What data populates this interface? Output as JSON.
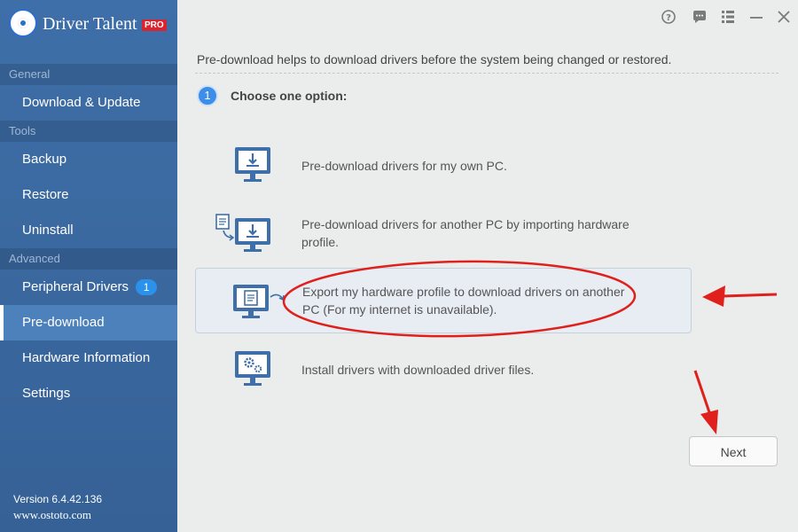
{
  "app": {
    "title": "Driver Talent",
    "badge": "PRO"
  },
  "sidebar": {
    "sections": [
      {
        "label": "General"
      },
      {
        "label": "Tools"
      },
      {
        "label": "Advanced"
      }
    ],
    "items": [
      {
        "label": "Download & Update"
      },
      {
        "label": "Backup"
      },
      {
        "label": "Restore"
      },
      {
        "label": "Uninstall"
      },
      {
        "label": "Peripheral Drivers",
        "badge": "1"
      },
      {
        "label": "Pre-download"
      },
      {
        "label": "Hardware Information"
      },
      {
        "label": "Settings"
      }
    ],
    "version": "Version 6.4.42.136",
    "website": "www.ostoto.com"
  },
  "main": {
    "intro": "Pre-download helps to download drivers before the system being changed or restored.",
    "step_number": "1",
    "step_label": "Choose one option:",
    "options": [
      {
        "text": "Pre-download drivers for my own PC."
      },
      {
        "text": "Pre-download drivers for another PC by importing hardware profile."
      },
      {
        "text": "Export my hardware profile to download drivers on another PC (For my internet is unavailable).",
        "selected": true
      },
      {
        "text": "Install drivers with downloaded driver files."
      }
    ],
    "next_label": "Next"
  },
  "colors": {
    "sidebar": "#3f6fa8",
    "accent": "#3d8ee8",
    "annotation": "#e0201c",
    "icon": "#3f6fa8"
  }
}
